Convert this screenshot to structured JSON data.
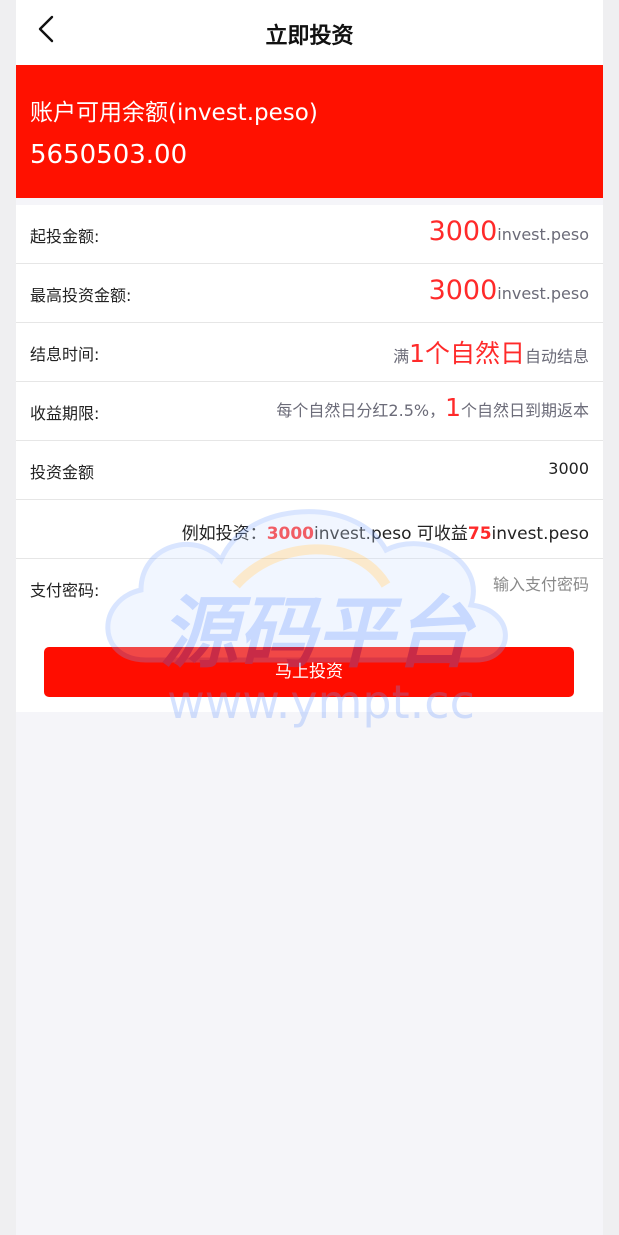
{
  "header": {
    "title": "立即投资",
    "back_icon": "chevron-left-icon"
  },
  "balance": {
    "label": "账户可用余额(invest.peso)",
    "amount": "5650503.00",
    "bg_color": "#ff1100"
  },
  "rows": {
    "min": {
      "label": "起投金额:",
      "value": "3000",
      "unit": "invest.peso"
    },
    "max": {
      "label": "最高投资金额:",
      "value": "3000",
      "unit": "invest.peso"
    },
    "settle": {
      "label": "结息时间:",
      "prefix": "满",
      "highlight": "1个自然日",
      "suffix": "自动结息"
    },
    "period": {
      "label": "收益期限:",
      "prefix": "每个自然日分红2.5%，",
      "highlight": "1",
      "suffix": "个自然日到期返本"
    },
    "amount": {
      "label": "投资金额",
      "value": "3000"
    },
    "example": {
      "prefix": "例如投资：",
      "invest": "3000",
      "unit1": "invest.peso 可收益",
      "profit": "75",
      "unit2": "invest.peso"
    },
    "password": {
      "label": "支付密码:",
      "placeholder": "输入支付密码"
    }
  },
  "submit": {
    "label": "马上投资"
  },
  "watermark": {
    "text": "源码平台",
    "url": "www.ympt.cc"
  }
}
